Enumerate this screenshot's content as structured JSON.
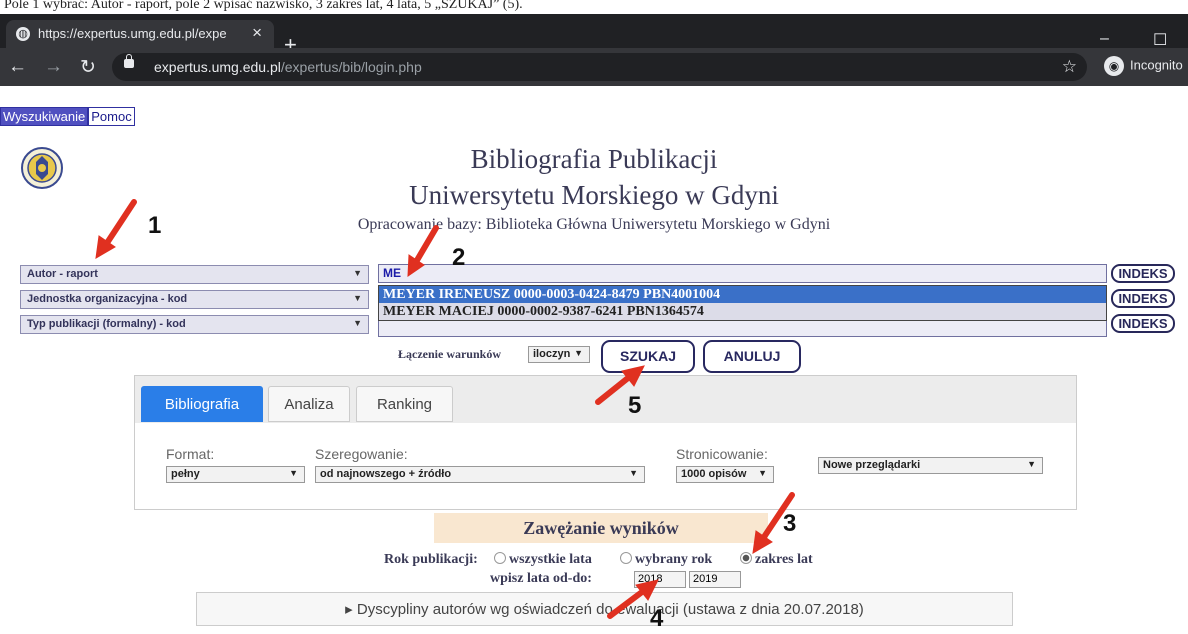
{
  "caption": {
    "text": "Pole 1 wybrać: Autor - raport, pole 2 wpisać nazwisko, 3 zakres lat, 4 lata, 5 „SZUKAJ” (5)."
  },
  "browser": {
    "tab_title": "https://expertus.umg.edu.pl/expe",
    "new_tab": "+",
    "url_host": "expertus.umg.edu.pl",
    "url_path": "/expertus/bib/login.php",
    "incognito": "Incognito"
  },
  "menu": {
    "search": "Wyszukiwanie",
    "help": "Pomoc"
  },
  "header": {
    "title1": "Bibliografia Publikacji",
    "title2": "Uniwersytetu Morskiego w Gdyni",
    "subtitle": "Opracowanie bazy: Biblioteka Główna Uniwersytetu Morskiego w Gdyni"
  },
  "search": {
    "field1": "Autor - raport",
    "field2": "Jednostka organizacyjna - kod",
    "field3": "Typ publikacji (formalny) - kod",
    "query": "ME",
    "suggestions": [
      "MEYER IRENEUSZ 0000-0003-0424-8479 PBN4001004",
      "MEYER MACIEJ 0000-0002-9387-6241 PBN1364574"
    ],
    "indeks": "INDEKS",
    "join_label": "Łączenie warunków",
    "join_value": "iloczyn",
    "search_btn": "SZUKAJ",
    "cancel_btn": "ANULUJ"
  },
  "tabs": [
    "Bibliografia",
    "Analiza",
    "Ranking"
  ],
  "options": {
    "format_label": "Format:",
    "format_value": "pełny",
    "sort_label": "Szeregowanie:",
    "sort_value": "od najnowszego + źródło",
    "paging_label": "Stronicowanie:",
    "paging_value": "1000 opisów",
    "browser_value": "Nowe przeglądarki"
  },
  "narrow": {
    "title": "Zawężanie wyników",
    "year_label": "Rok publikacji:",
    "opt_all": "wszystkie lata",
    "opt_one": "wybrany rok",
    "opt_range": "zakres lat",
    "range_label": "wpisz lata od-do:",
    "from": "2018",
    "to": "2019",
    "selected": "range"
  },
  "accordion": "▸ Dyscypliny autorów wg oświadczeń do ewaluacji (ustawa z dnia 20.07.2018)",
  "annotations": [
    "1",
    "2",
    "3",
    "4",
    "5"
  ],
  "colors": {
    "arrow": "#e03020",
    "accent": "#2a7ee8",
    "highlight": "#3a70c8"
  }
}
